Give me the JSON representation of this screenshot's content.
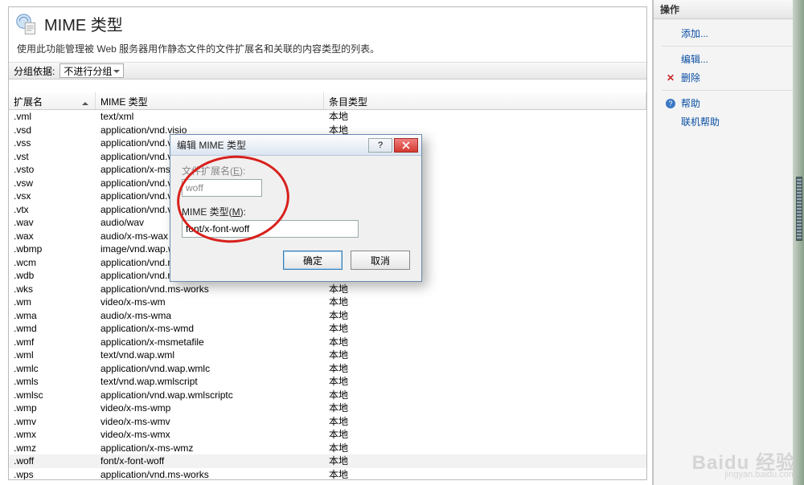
{
  "header": {
    "title": "MIME 类型",
    "subtitle": "使用此功能管理被 Web 服务器用作静态文件的文件扩展名和关联的内容类型的列表。"
  },
  "grouping": {
    "label": "分组依据:",
    "value": "不进行分组"
  },
  "columns": {
    "ext": "扩展名",
    "mime": "MIME 类型",
    "src": "条目类型"
  },
  "src_local": "本地",
  "rows": [
    {
      "ext": ".vml",
      "mime": "text/xml"
    },
    {
      "ext": ".vsd",
      "mime": "application/vnd.visio"
    },
    {
      "ext": ".vss",
      "mime": "application/vnd.visio"
    },
    {
      "ext": ".vst",
      "mime": "application/vnd.visio"
    },
    {
      "ext": ".vsto",
      "mime": "application/x-ms-vsto"
    },
    {
      "ext": ".vsw",
      "mime": "application/vnd.visio"
    },
    {
      "ext": ".vsx",
      "mime": "application/vnd.visio"
    },
    {
      "ext": ".vtx",
      "mime": "application/vnd.visio"
    },
    {
      "ext": ".wav",
      "mime": "audio/wav"
    },
    {
      "ext": ".wax",
      "mime": "audio/x-ms-wax"
    },
    {
      "ext": ".wbmp",
      "mime": "image/vnd.wap.wbmp"
    },
    {
      "ext": ".wcm",
      "mime": "application/vnd.ms-works"
    },
    {
      "ext": ".wdb",
      "mime": "application/vnd.ms-works"
    },
    {
      "ext": ".wks",
      "mime": "application/vnd.ms-works"
    },
    {
      "ext": ".wm",
      "mime": "video/x-ms-wm"
    },
    {
      "ext": ".wma",
      "mime": "audio/x-ms-wma"
    },
    {
      "ext": ".wmd",
      "mime": "application/x-ms-wmd"
    },
    {
      "ext": ".wmf",
      "mime": "application/x-msmetafile"
    },
    {
      "ext": ".wml",
      "mime": "text/vnd.wap.wml"
    },
    {
      "ext": ".wmlc",
      "mime": "application/vnd.wap.wmlc"
    },
    {
      "ext": ".wmls",
      "mime": "text/vnd.wap.wmlscript"
    },
    {
      "ext": ".wmlsc",
      "mime": "application/vnd.wap.wmlscriptc"
    },
    {
      "ext": ".wmp",
      "mime": "video/x-ms-wmp"
    },
    {
      "ext": ".wmv",
      "mime": "video/x-ms-wmv"
    },
    {
      "ext": ".wmx",
      "mime": "video/x-ms-wmx"
    },
    {
      "ext": ".wmz",
      "mime": "application/x-ms-wmz"
    },
    {
      "ext": ".woff",
      "mime": "font/x-font-woff",
      "sel": true
    },
    {
      "ext": ".wps",
      "mime": "application/vnd.ms-works"
    }
  ],
  "dialog": {
    "title": "编辑 MIME 类型",
    "ext_label_pre": "文件扩展名(",
    "ext_label_u": "E",
    "ext_label_post": "):",
    "ext_value": "woff",
    "mime_label_pre": "MIME 类型(",
    "mime_label_u": "M",
    "mime_label_post": "):",
    "mime_value": "font/x-font-woff",
    "ok": "确定",
    "cancel": "取消",
    "help_glyph": "?"
  },
  "actions": {
    "pane_title": "操作",
    "add": "添加...",
    "edit": "编辑...",
    "delete": "删除",
    "help": "帮助",
    "online_help": "联机帮助"
  },
  "watermark": {
    "logo": "Baidu 经验",
    "sub": "jingyan.baidu.com"
  }
}
